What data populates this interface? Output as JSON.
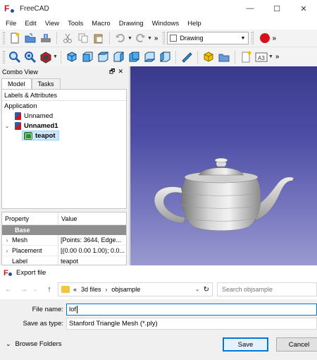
{
  "window": {
    "title": "FreeCAD",
    "controls": [
      "—",
      "☐",
      "✕"
    ]
  },
  "menu": [
    "File",
    "Edit",
    "View",
    "Tools",
    "Macro",
    "Drawing",
    "Windows",
    "Help"
  ],
  "toolbar": {
    "workbench": "Drawing",
    "chevron": "»"
  },
  "combo_view": {
    "title": "Combo View",
    "header_icons": "🗗✕",
    "tabs": [
      "Model",
      "Tasks"
    ],
    "tree_header": "Labels & Attributes",
    "tree": {
      "root": "Application",
      "items": [
        {
          "label": "Unnamed",
          "expanded": false
        },
        {
          "label": "Unnamed1",
          "expanded": true,
          "bold": true
        },
        {
          "label": "teapot",
          "selected": true
        }
      ]
    },
    "properties": {
      "col_property": "Property",
      "col_value": "Value",
      "group": "Base",
      "rows": [
        {
          "name": "Mesh",
          "value": "[Points: 3644, Edge..."
        },
        {
          "name": "Placement",
          "value": "[(0.00 0.00 1.00); 0.0..."
        },
        {
          "name": "Label",
          "value": "teapot"
        }
      ]
    }
  },
  "dialog": {
    "title": "Export file",
    "path": [
      "3d files",
      "objsample"
    ],
    "path_prefix": "«",
    "search_placeholder": "Search objsample",
    "file_name_label": "File name:",
    "file_name_value": "lof",
    "save_as_label": "Save as type:",
    "save_as_value": "Stanford Triangle Mesh (*.ply)",
    "browse_folders": "Browse Folders",
    "save_button": "Save",
    "cancel_button": "Cancel"
  },
  "colors": {
    "record": "#d7101a",
    "accent": "#0078d7",
    "viewport_top": "#3a3a8c",
    "viewport_bottom": "#9a9ad0"
  }
}
